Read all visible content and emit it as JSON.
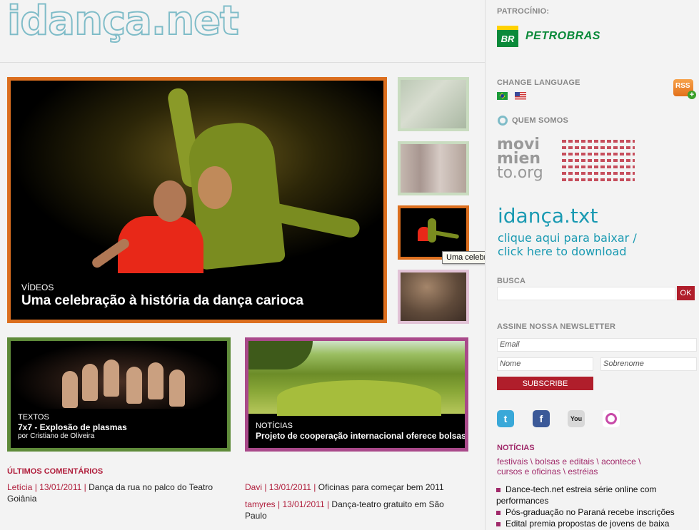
{
  "header": {
    "logo": "idança.net"
  },
  "sponsor": {
    "label": "PATROCÍNIO:",
    "name": "PETROBRAS",
    "badge": "BR"
  },
  "featured": {
    "category": "VÍDEOS",
    "title": "Uma celebração à história da dança carioca"
  },
  "tooltip": "Uma celebração à história da dança carioca",
  "cards": [
    {
      "category": "TEXTOS",
      "title": "7x7 - Explosão de plasmas",
      "byline": "por Cristiano de Oliveira"
    },
    {
      "category": "NOTÍCIAS",
      "title": "Projeto de cooperação internacional oferece bolsas"
    }
  ],
  "comments": {
    "title": "ÚLTIMOS COMENTÁRIOS",
    "items": [
      {
        "meta": "Letícia | 13/01/2011 |",
        "text": " Dança da rua no palco do Teatro Goiânia"
      },
      {
        "meta": "Davi | 13/01/2011 |",
        "text": " Oficinas para começar bem 2011"
      },
      {
        "meta": "tamyres | 13/01/2011 |",
        "text": " Dança-teatro gratuito em São Paulo"
      }
    ]
  },
  "language": {
    "label": "CHANGE LANGUAGE",
    "rss": "RSS"
  },
  "about": {
    "label": "QUEM SOMOS",
    "movimiento": [
      "movi",
      "mien",
      "to.org"
    ]
  },
  "txt": {
    "title": "idança.txt",
    "line1": "clique aqui para baixar /",
    "line2": "click here to download"
  },
  "search": {
    "label": "BUSCA",
    "ok": "OK"
  },
  "newsletter": {
    "label": "ASSINE NOSSA NEWSLETTER",
    "email": "Email",
    "nome": "Nome",
    "sobrenome": "Sobrenome",
    "subscribe": "SUBSCRIBE"
  },
  "social": {
    "twitter": "t",
    "facebook": "f",
    "youtube": "You",
    "orkut": ""
  },
  "noticias": {
    "label": "NOTÍCIAS",
    "cats1": "festivais \\ bolsas e editais \\ acontece \\",
    "cats2": "cursos e oficinas \\ estréias",
    "items": [
      "Dance-tech.net estreia série online com performances",
      "Pós-graduação no Paraná recebe inscrições",
      "Edital premia propostas de jovens de baixa"
    ]
  },
  "colors": {
    "video": "#dc6f1f",
    "texts": "#5f8b3a",
    "news": "#a9498a",
    "accent": "#b01e2b",
    "logo": "#7fbcc8"
  }
}
